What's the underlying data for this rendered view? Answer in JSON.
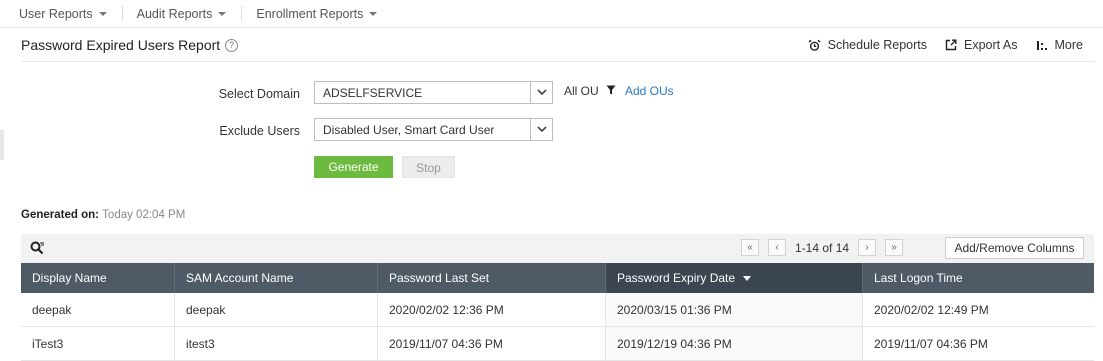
{
  "nav": {
    "items": [
      {
        "label": "User Reports"
      },
      {
        "label": "Audit Reports"
      },
      {
        "label": "Enrollment Reports"
      }
    ]
  },
  "header": {
    "title": "Password Expired Users Report",
    "help": "?",
    "actions": {
      "schedule": "Schedule Reports",
      "export": "Export As",
      "more": "More"
    }
  },
  "form": {
    "domain_label": "Select Domain",
    "domain_value": "ADSELFSERVICE",
    "ou_text": "All OU",
    "add_ous": "Add OUs",
    "exclude_label": "Exclude Users",
    "exclude_value": "Disabled User, Smart Card User",
    "generate": "Generate",
    "stop": "Stop"
  },
  "generated": {
    "label": "Generated on:",
    "time": "Today 02:04 PM"
  },
  "toolbar": {
    "first": "«",
    "prev": "‹",
    "range": "1-14 of 14",
    "next": "›",
    "last": "»",
    "columns_button": "Add/Remove Columns"
  },
  "table": {
    "headers": [
      "Display Name",
      "SAM Account Name",
      "Password Last Set",
      "Password Expiry Date",
      "Last Logon Time"
    ],
    "sorted_column": "Password Expiry Date",
    "rows": [
      [
        "deepak",
        "deepak",
        "2020/02/02 12:36 PM",
        "2020/03/15 01:36 PM",
        "2020/02/02 12:49 PM"
      ],
      [
        "iTest3",
        "itest3",
        "2019/11/07 04:36 PM",
        "2019/12/19 04:36 PM",
        "2019/11/07 04:36 PM"
      ]
    ]
  },
  "colors": {
    "accent_green": "#6dbb3e",
    "link_blue": "#2a7ac2",
    "table_header": "#4e5b66"
  }
}
